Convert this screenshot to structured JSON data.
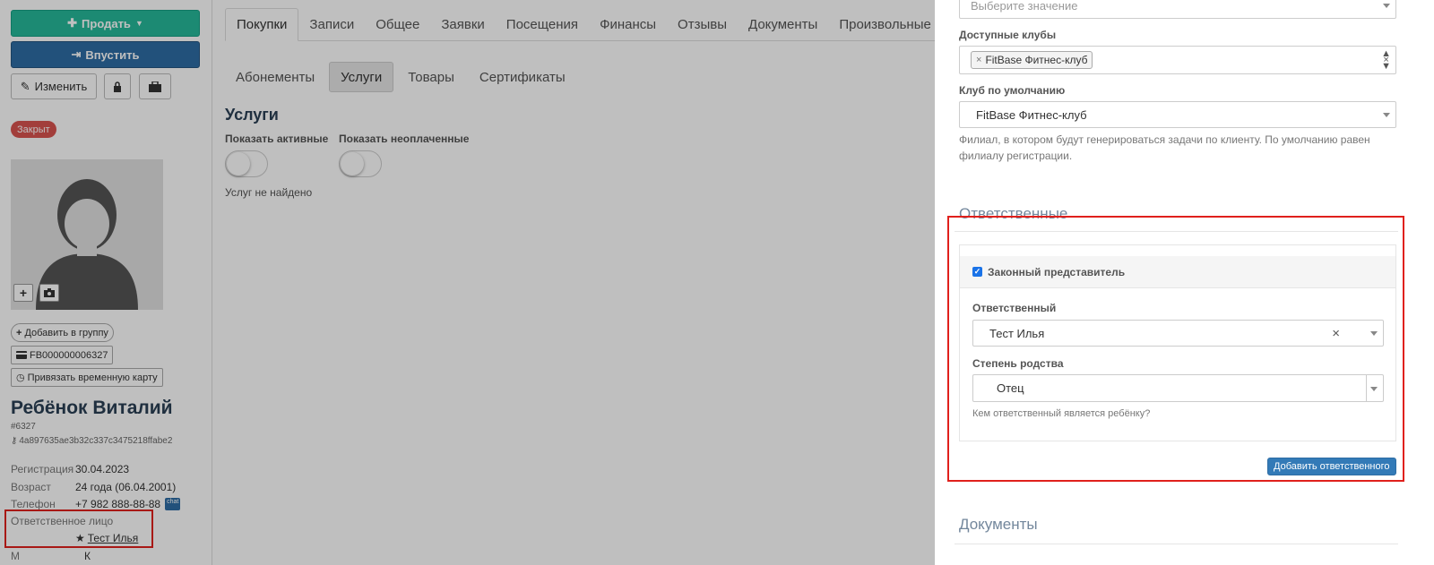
{
  "sidebar": {
    "sell_label": "Продать",
    "enter_label": "Впустить",
    "edit_label": "Изменить",
    "status_badge": "Закрыт",
    "add_group_label": "Добавить в группу",
    "card_number": "FB000000006327",
    "temp_card_label": "Привязать временную карту",
    "client_name": "Ребёнок Виталий",
    "client_id": "#6327",
    "client_hash": "4a897635ae3b32c337c3475218ffabe2",
    "info": [
      {
        "label": "Регистрация",
        "value": "30.04.2023"
      },
      {
        "label": "Возраст",
        "value": "24 года (06.04.2001)"
      },
      {
        "label": "Телефон",
        "value": "+7 982 888-88-88"
      }
    ],
    "chat_badge": "chat",
    "responsible_label": "Ответственное лицо",
    "responsible_name": "Тест Илья",
    "cut_row": {
      "label": "М",
      "value": "К"
    }
  },
  "tabs": [
    "Покупки",
    "Записи",
    "Общее",
    "Заявки",
    "Посещения",
    "Финансы",
    "Отзывы",
    "Документы",
    "Произвольные"
  ],
  "subtabs": [
    "Абонементы",
    "Услуги",
    "Товары",
    "Сертификаты"
  ],
  "services": {
    "title": "Услуги",
    "show_active_label": "Показать активные",
    "show_unpaid_label": "Показать неоплаченные",
    "empty_text": "Услуг не найдено"
  },
  "panel": {
    "top_select_placeholder": "Выберите значение",
    "available_clubs_label": "Доступные клубы",
    "available_clubs_tag": "FitBase Фитнес-клуб",
    "default_club_label": "Клуб по умолчанию",
    "default_club_value": "FitBase Фитнес-клуб",
    "default_club_help": "Филиал, в котором будут генерироваться задачи по клиенту. По умолчанию равен филиалу регистрации.",
    "responsible_section": "Ответственные",
    "legal_rep_label": "Законный представитель",
    "responsible_label": "Ответственный",
    "responsible_value": "Тест Илья",
    "kinship_label": "Степень родства",
    "kinship_value": "Отец",
    "kinship_help": "Кем ответственный является ребёнку?",
    "add_responsible_label": "Добавить ответственного",
    "documents_section": "Документы"
  },
  "colors": {
    "sell_button": "#26b99a",
    "enter_button": "#2e6da4",
    "status_badge": "#d9534f",
    "highlight": "#e0201c",
    "primary_button": "#337ab7"
  }
}
